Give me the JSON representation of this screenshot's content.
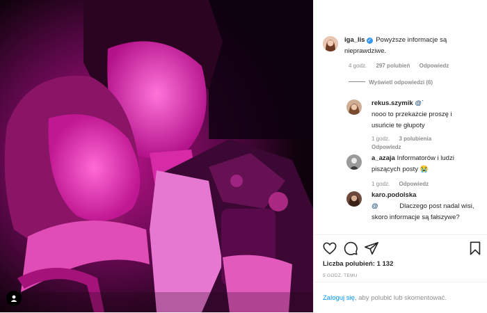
{
  "post": {
    "likes_label": "Liczba polubień: 1 132",
    "time_label": "5 GODZ. TEMU"
  },
  "comments": [
    {
      "username": "iga_lis",
      "verified": true,
      "text": "Powyższe informacje są nieprawdziwe.",
      "time": "4 godz.",
      "likes": "297 polubień",
      "reply": "Odpowiedz"
    },
    {
      "view_replies": "Wyświetl odpowiedzi (6)"
    },
    {
      "username": "rekus.szymik",
      "mention": "@`",
      "text": "nooo to przekażcie proszę i usuńcie te głupoty",
      "time": "1 godz.",
      "likes": "3 polubienia",
      "reply": "Odpowiedz"
    },
    {
      "username": "a_azaja",
      "text": "Informatorów i ludzi piszących posty",
      "emoji": "😭",
      "time": "1 godz.",
      "reply": "Odpowiedz"
    },
    {
      "username": "karo.podolska",
      "mention": "@",
      "text": "Dlaczego post nadal wisi, skoro informacje są fałszywe?"
    }
  ],
  "login": {
    "link": "Zaloguj się",
    "rest": ", aby polubić lub skomentować."
  },
  "icons": {
    "like": "heart-icon",
    "comment": "comment-icon",
    "share": "share-icon",
    "save": "bookmark-icon",
    "user_tag": "user-tag-icon"
  },
  "colors": {
    "link": "#0095f6",
    "verified": "#3897f0",
    "muted": "#8e8e8e"
  }
}
